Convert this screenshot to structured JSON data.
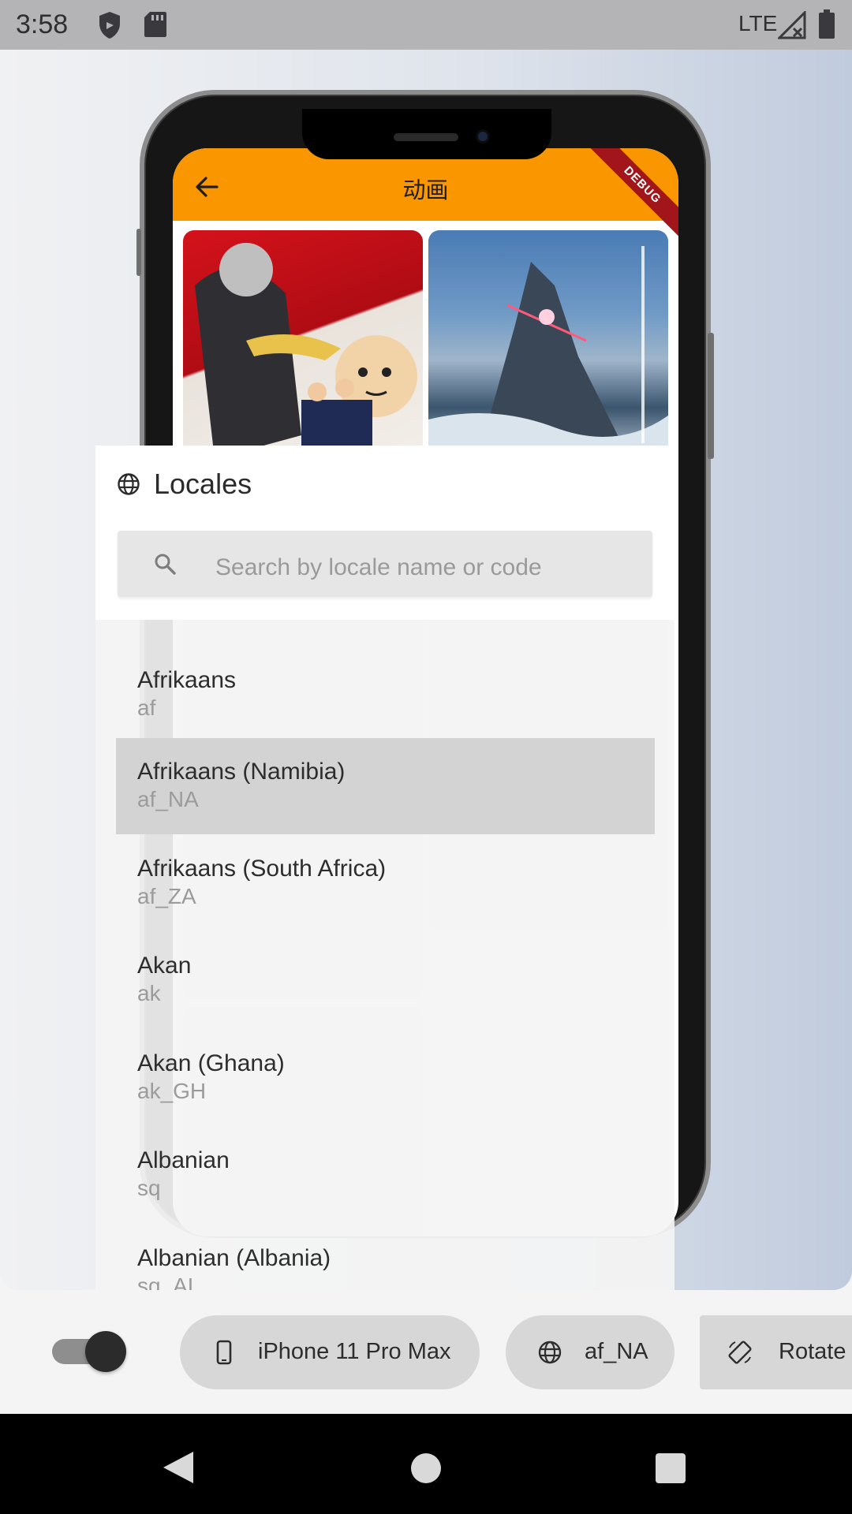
{
  "status_bar": {
    "time": "3:58",
    "network": "LTE",
    "icons": [
      "shield-icon",
      "sd-card-icon",
      "signal-icon",
      "battery-icon"
    ]
  },
  "preview_app": {
    "title": "动画",
    "debug_banner": "DEBUG",
    "accent_color": "#fa9600",
    "back_icon": "arrow-back-icon"
  },
  "locales_panel": {
    "title": "Locales",
    "title_icon": "globe-icon",
    "search": {
      "placeholder": "Search by locale name or code",
      "icon": "search-icon"
    },
    "items": [
      {
        "name": "Afrikaans",
        "code": "af",
        "selected": false
      },
      {
        "name": "Afrikaans (Namibia)",
        "code": "af_NA",
        "selected": true
      },
      {
        "name": "Afrikaans (South Africa)",
        "code": "af_ZA",
        "selected": false
      },
      {
        "name": "Akan",
        "code": "ak",
        "selected": false
      },
      {
        "name": "Akan (Ghana)",
        "code": "ak_GH",
        "selected": false
      },
      {
        "name": "Albanian",
        "code": "sq",
        "selected": false
      },
      {
        "name": "Albanian (Albania)",
        "code": "sq_AL",
        "selected": false
      }
    ]
  },
  "toolbar": {
    "toggle_on": true,
    "device_label": "iPhone 11 Pro Max",
    "device_icon": "phone-icon",
    "locale_label": "af_NA",
    "locale_icon": "globe-icon",
    "rotate_label": "Rotate",
    "rotate_icon": "rotate-icon"
  },
  "nav_bar": {
    "icons": [
      "back-icon",
      "home-icon",
      "recents-icon"
    ]
  }
}
